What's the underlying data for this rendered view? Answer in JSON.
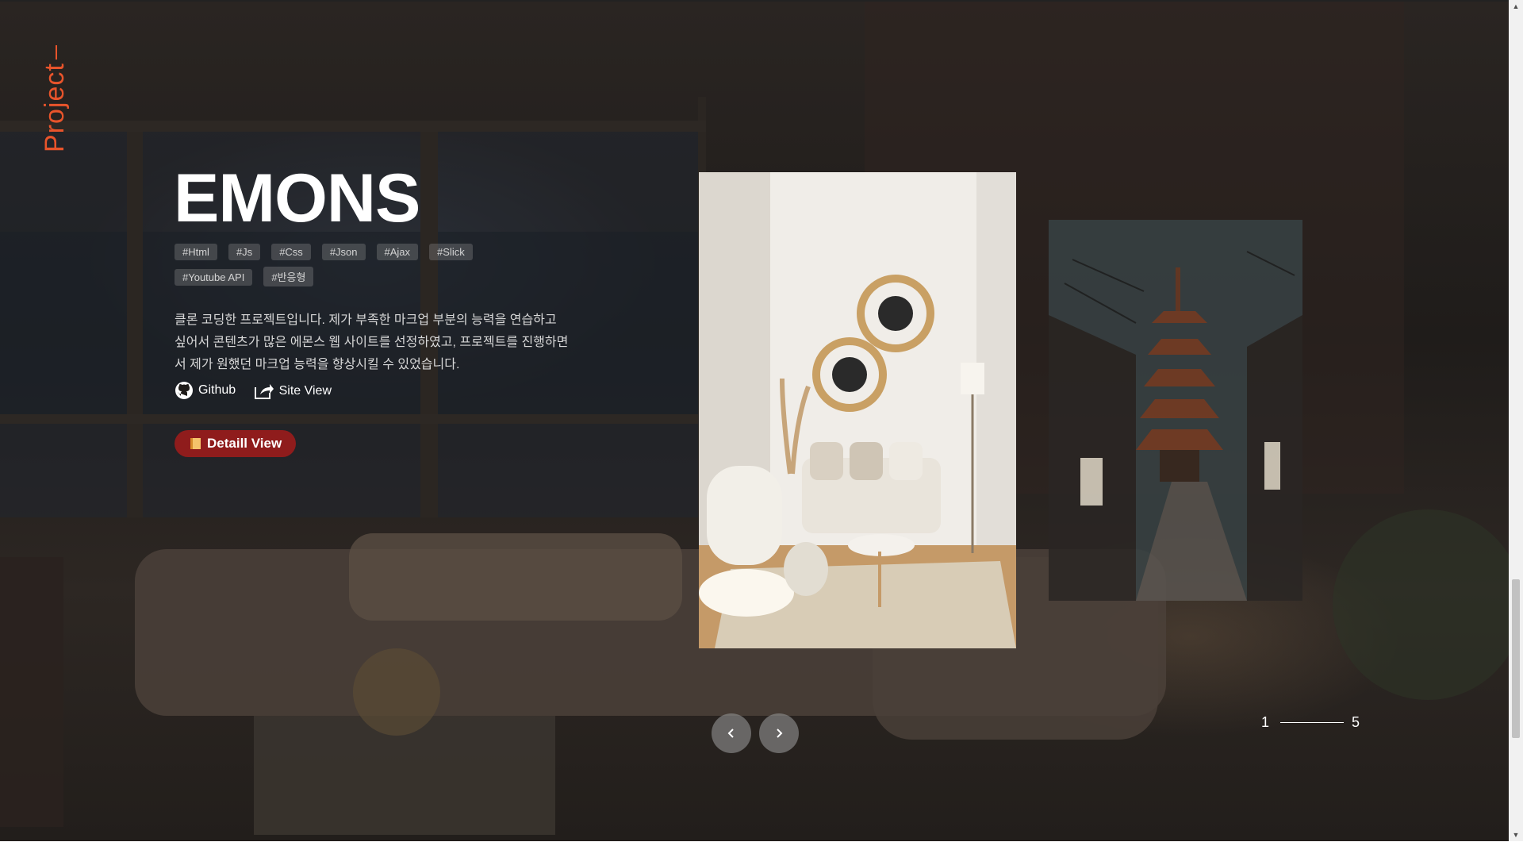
{
  "section": {
    "label": "Project"
  },
  "project": {
    "title": "EMONS",
    "tags": [
      "#Html",
      "#Js",
      "#Css",
      "#Json",
      "#Ajax",
      "#Slick",
      "#Youtube API",
      "#반응형"
    ],
    "description": "클론 코딩한 프로젝트입니다. 제가 부족한 마크업 부분의 능력을 연습하고 싶어서 콘텐츠가 많은 에몬스 웹 사이트를 선정하였고, 프로젝트를 진행하면서 제가 원했던 마크업 능력을 향상시킬 수 있었습니다.",
    "links": {
      "github": "Github",
      "site_view": "Site View"
    },
    "detail_button": "Detaill View"
  },
  "pagination": {
    "current": "1",
    "total": "5"
  },
  "icons": {
    "github": "github-icon",
    "site_view": "external-link-icon",
    "detail": "book-icon",
    "prev": "chevron-left-icon",
    "next": "chevron-right-icon"
  },
  "colors": {
    "accent": "#e8542b",
    "button": "#8f1c1c",
    "text": "#ffffff"
  }
}
